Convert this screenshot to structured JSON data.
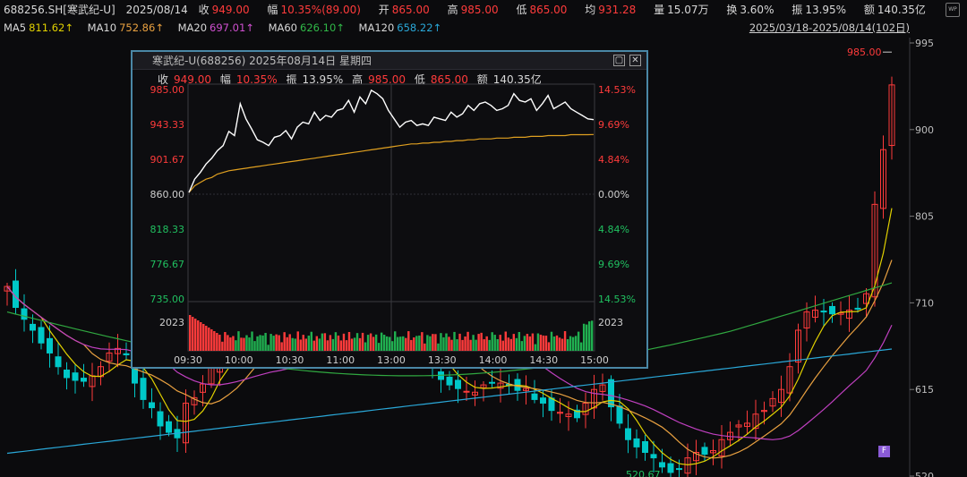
{
  "header": {
    "code": "688256.SH[寒武纪-U]",
    "date": "2025/08/14",
    "close_label": "收",
    "close": "949.00",
    "amp_label": "幅",
    "amp": "10.35%(89.00)",
    "open_label": "开",
    "open": "865.00",
    "high_label": "高",
    "high": "985.00",
    "low_label": "低",
    "low": "865.00",
    "avg_label": "均",
    "avg": "931.28",
    "vol_label": "量",
    "vol": "15.07万",
    "turn_label": "换",
    "turn": "3.60%",
    "swing_label": "振",
    "swing": "13.95%",
    "amt_label": "额",
    "amt": "140.35亿",
    "corner_icon": "wp-icon",
    "corner_text": "WP"
  },
  "ma_bar": {
    "ma5_label": "MA5",
    "ma5": "811.62↑",
    "ma10_label": "MA10",
    "ma10": "752.86↑",
    "ma20_label": "MA20",
    "ma20": "697.01↑",
    "ma60_label": "MA60",
    "ma60": "626.10↑",
    "ma120_label": "MA120",
    "ma120": "658.22↑",
    "range": "2025/03/18-2025/08/14(102日)"
  },
  "colors": {
    "up": "#ff3b3b",
    "down": "#00c8c8",
    "ma5": "#e0d000",
    "ma10": "#e8a040",
    "ma20": "#c040c0",
    "ma60": "#30a840",
    "ma120": "#2aa8d8",
    "price_line": "#ffffff",
    "avg_line": "#e0a020"
  },
  "chart_data": [
    {
      "type": "line",
      "name": "daily-kline",
      "y_axis_ticks": [
        "995",
        "900",
        "805",
        "710",
        "615",
        "520"
      ],
      "annotations": {
        "max_label": "985.00",
        "min_label": "520.67"
      },
      "badge": "F",
      "x_days": 102,
      "ma_values_last": {
        "MA5": 811.62,
        "MA10": 752.86,
        "MA20": 697.01,
        "MA60": 626.1,
        "MA120": 658.22
      },
      "series": [
        {
          "values": [
            728,
            705,
            692,
            680,
            666,
            655,
            640,
            628,
            625,
            624,
            630,
            640,
            655,
            660,
            653,
            622,
            604,
            595,
            575,
            568,
            562,
            600,
            606,
            621,
            640,
            655,
            668,
            670,
            676,
            680,
            682,
            688,
            690,
            700,
            706,
            718,
            726,
            730,
            728,
            735,
            740,
            745,
            742,
            735,
            728,
            716,
            700,
            688,
            672,
            654,
            640,
            626,
            620,
            616,
            613,
            612,
            620,
            622,
            622,
            620,
            614,
            616,
            604,
            600,
            592,
            590,
            588,
            584,
            600,
            615,
            620,
            596,
            578,
            560,
            552,
            546,
            540,
            530,
            524,
            528,
            540,
            546,
            544,
            548,
            560,
            568,
            576,
            578,
            588,
            592,
            605,
            615,
            640,
            680,
            700,
            702,
            700,
            698,
            699,
            702,
            704,
            720,
            818,
            878,
            949
          ]
        }
      ]
    },
    {
      "type": "line",
      "name": "intraday",
      "title": "寒武纪-U(688256) 2025年08月14日 星期四",
      "info": {
        "close_label": "收",
        "close": "949.00",
        "amp_label": "幅",
        "amp": "10.35%",
        "swing_label": "振",
        "swing": "13.95%",
        "high_label": "高",
        "high": "985.00",
        "low_label": "低",
        "low": "865.00",
        "amt_label": "额",
        "amt": "140.35亿"
      },
      "y_left": [
        "985.00",
        "943.33",
        "901.67",
        "860.00",
        "818.33",
        "776.67",
        "735.00"
      ],
      "y_right": [
        "14.53%",
        "9.69%",
        "4.84%",
        "0.00%",
        "4.84%",
        "9.69%",
        "14.53%"
      ],
      "vol_label_left": "2023",
      "vol_label_right": "2023",
      "x_ticks": [
        "09:30",
        "10:00",
        "10:30",
        "11:00",
        "13:00",
        "13:30",
        "14:00",
        "14:30",
        "15:00"
      ],
      "ylim": [
        735,
        985
      ],
      "series": [
        {
          "values": [
            862,
            878,
            886,
            896,
            903,
            912,
            918,
            935,
            930,
            968,
            950,
            938,
            925,
            922,
            918,
            928,
            930,
            936,
            926,
            940,
            946,
            944,
            958,
            948,
            954,
            952,
            960,
            962,
            972,
            958,
            976,
            968,
            984,
            980,
            974,
            960,
            950,
            940,
            946,
            948,
            942,
            944,
            942,
            952,
            950,
            948,
            958,
            952,
            956,
            966,
            960,
            968,
            970,
            966,
            960,
            962,
            966,
            980,
            972,
            970,
            974,
            960,
            968,
            978,
            962,
            966,
            970,
            962,
            958,
            954,
            950,
            949
          ]
        },
        {
          "values": [
            862,
            870,
            874,
            878,
            880,
            884,
            886,
            888,
            889,
            890,
            891,
            892,
            893,
            894,
            895,
            896,
            897,
            898,
            899,
            900,
            901,
            902,
            903,
            904,
            905,
            906,
            907,
            908,
            909,
            910,
            911,
            912,
            913,
            914,
            915,
            916,
            917,
            918,
            919,
            920,
            920,
            921,
            921,
            922,
            922,
            923,
            923,
            924,
            924,
            925,
            925,
            926,
            926,
            926,
            927,
            927,
            927,
            928,
            928,
            928,
            929,
            929,
            929,
            930,
            930,
            930,
            930,
            931,
            931,
            931,
            931,
            931.28
          ]
        }
      ]
    }
  ]
}
